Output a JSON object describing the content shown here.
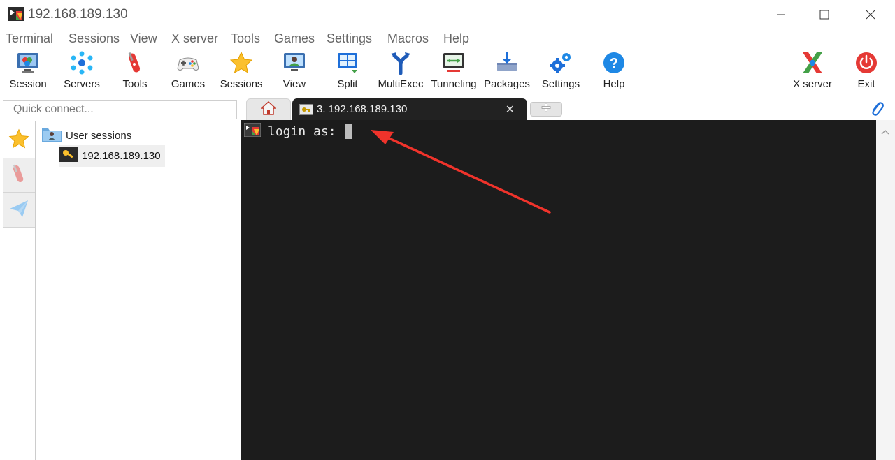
{
  "window": {
    "title": "192.168.189.130",
    "app_icon": "mobaxterm-icon"
  },
  "menu": [
    "Terminal",
    "Sessions",
    "View",
    "X server",
    "Tools",
    "Games",
    "Settings",
    "Macros",
    "Help"
  ],
  "toolbar": {
    "items": [
      {
        "label": "Session",
        "icon": "monitor-session-icon"
      },
      {
        "label": "Servers",
        "icon": "servers-icon"
      },
      {
        "label": "Tools",
        "icon": "tools-icon"
      },
      {
        "label": "Games",
        "icon": "gamepad-icon"
      },
      {
        "label": "Sessions",
        "icon": "star-icon"
      },
      {
        "label": "View",
        "icon": "view-icon"
      },
      {
        "label": "Split",
        "icon": "split-icon"
      },
      {
        "label": "MultiExec",
        "icon": "multiexec-icon"
      },
      {
        "label": "Tunneling",
        "icon": "tunneling-icon"
      },
      {
        "label": "Packages",
        "icon": "packages-icon"
      },
      {
        "label": "Settings",
        "icon": "gears-icon"
      },
      {
        "label": "Help",
        "icon": "help-icon"
      }
    ],
    "xserver_label": "X server",
    "exit_label": "Exit"
  },
  "quick_connect": {
    "placeholder": "Quick connect...",
    "value": ""
  },
  "tabs": [
    {
      "label": "3. 192.168.189.130",
      "active": true
    }
  ],
  "sidebar": {
    "root_label": "User sessions",
    "sessions": [
      {
        "label": "192.168.189.130"
      }
    ]
  },
  "terminal": {
    "prompt": "login as: "
  },
  "colors": {
    "terminal_bg": "#1c1c1c",
    "tab_active_bg": "#222222",
    "annotation_arrow": "#f0332b",
    "help_blue": "#1e88e5",
    "exit_red": "#e53935"
  }
}
